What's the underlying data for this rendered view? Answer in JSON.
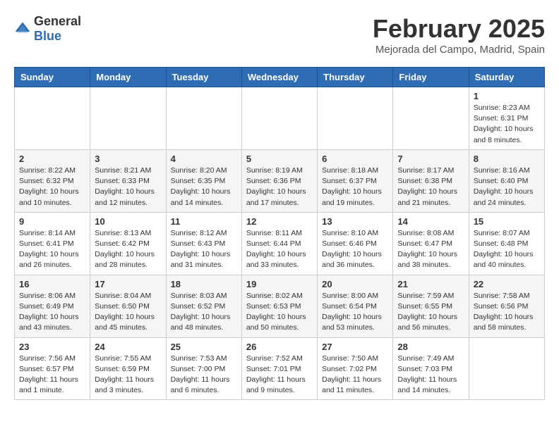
{
  "header": {
    "logo_general": "General",
    "logo_blue": "Blue",
    "month_title": "February 2025",
    "location": "Mejorada del Campo, Madrid, Spain"
  },
  "weekdays": [
    "Sunday",
    "Monday",
    "Tuesday",
    "Wednesday",
    "Thursday",
    "Friday",
    "Saturday"
  ],
  "weeks": [
    [
      {
        "day": "",
        "info": ""
      },
      {
        "day": "",
        "info": ""
      },
      {
        "day": "",
        "info": ""
      },
      {
        "day": "",
        "info": ""
      },
      {
        "day": "",
        "info": ""
      },
      {
        "day": "",
        "info": ""
      },
      {
        "day": "1",
        "info": "Sunrise: 8:23 AM\nSunset: 6:31 PM\nDaylight: 10 hours and 8 minutes."
      }
    ],
    [
      {
        "day": "2",
        "info": "Sunrise: 8:22 AM\nSunset: 6:32 PM\nDaylight: 10 hours and 10 minutes."
      },
      {
        "day": "3",
        "info": "Sunrise: 8:21 AM\nSunset: 6:33 PM\nDaylight: 10 hours and 12 minutes."
      },
      {
        "day": "4",
        "info": "Sunrise: 8:20 AM\nSunset: 6:35 PM\nDaylight: 10 hours and 14 minutes."
      },
      {
        "day": "5",
        "info": "Sunrise: 8:19 AM\nSunset: 6:36 PM\nDaylight: 10 hours and 17 minutes."
      },
      {
        "day": "6",
        "info": "Sunrise: 8:18 AM\nSunset: 6:37 PM\nDaylight: 10 hours and 19 minutes."
      },
      {
        "day": "7",
        "info": "Sunrise: 8:17 AM\nSunset: 6:38 PM\nDaylight: 10 hours and 21 minutes."
      },
      {
        "day": "8",
        "info": "Sunrise: 8:16 AM\nSunset: 6:40 PM\nDaylight: 10 hours and 24 minutes."
      }
    ],
    [
      {
        "day": "9",
        "info": "Sunrise: 8:14 AM\nSunset: 6:41 PM\nDaylight: 10 hours and 26 minutes."
      },
      {
        "day": "10",
        "info": "Sunrise: 8:13 AM\nSunset: 6:42 PM\nDaylight: 10 hours and 28 minutes."
      },
      {
        "day": "11",
        "info": "Sunrise: 8:12 AM\nSunset: 6:43 PM\nDaylight: 10 hours and 31 minutes."
      },
      {
        "day": "12",
        "info": "Sunrise: 8:11 AM\nSunset: 6:44 PM\nDaylight: 10 hours and 33 minutes."
      },
      {
        "day": "13",
        "info": "Sunrise: 8:10 AM\nSunset: 6:46 PM\nDaylight: 10 hours and 36 minutes."
      },
      {
        "day": "14",
        "info": "Sunrise: 8:08 AM\nSunset: 6:47 PM\nDaylight: 10 hours and 38 minutes."
      },
      {
        "day": "15",
        "info": "Sunrise: 8:07 AM\nSunset: 6:48 PM\nDaylight: 10 hours and 40 minutes."
      }
    ],
    [
      {
        "day": "16",
        "info": "Sunrise: 8:06 AM\nSunset: 6:49 PM\nDaylight: 10 hours and 43 minutes."
      },
      {
        "day": "17",
        "info": "Sunrise: 8:04 AM\nSunset: 6:50 PM\nDaylight: 10 hours and 45 minutes."
      },
      {
        "day": "18",
        "info": "Sunrise: 8:03 AM\nSunset: 6:52 PM\nDaylight: 10 hours and 48 minutes."
      },
      {
        "day": "19",
        "info": "Sunrise: 8:02 AM\nSunset: 6:53 PM\nDaylight: 10 hours and 50 minutes."
      },
      {
        "day": "20",
        "info": "Sunrise: 8:00 AM\nSunset: 6:54 PM\nDaylight: 10 hours and 53 minutes."
      },
      {
        "day": "21",
        "info": "Sunrise: 7:59 AM\nSunset: 6:55 PM\nDaylight: 10 hours and 56 minutes."
      },
      {
        "day": "22",
        "info": "Sunrise: 7:58 AM\nSunset: 6:56 PM\nDaylight: 10 hours and 58 minutes."
      }
    ],
    [
      {
        "day": "23",
        "info": "Sunrise: 7:56 AM\nSunset: 6:57 PM\nDaylight: 11 hours and 1 minute."
      },
      {
        "day": "24",
        "info": "Sunrise: 7:55 AM\nSunset: 6:59 PM\nDaylight: 11 hours and 3 minutes."
      },
      {
        "day": "25",
        "info": "Sunrise: 7:53 AM\nSunset: 7:00 PM\nDaylight: 11 hours and 6 minutes."
      },
      {
        "day": "26",
        "info": "Sunrise: 7:52 AM\nSunset: 7:01 PM\nDaylight: 11 hours and 9 minutes."
      },
      {
        "day": "27",
        "info": "Sunrise: 7:50 AM\nSunset: 7:02 PM\nDaylight: 11 hours and 11 minutes."
      },
      {
        "day": "28",
        "info": "Sunrise: 7:49 AM\nSunset: 7:03 PM\nDaylight: 11 hours and 14 minutes."
      },
      {
        "day": "",
        "info": ""
      }
    ]
  ]
}
